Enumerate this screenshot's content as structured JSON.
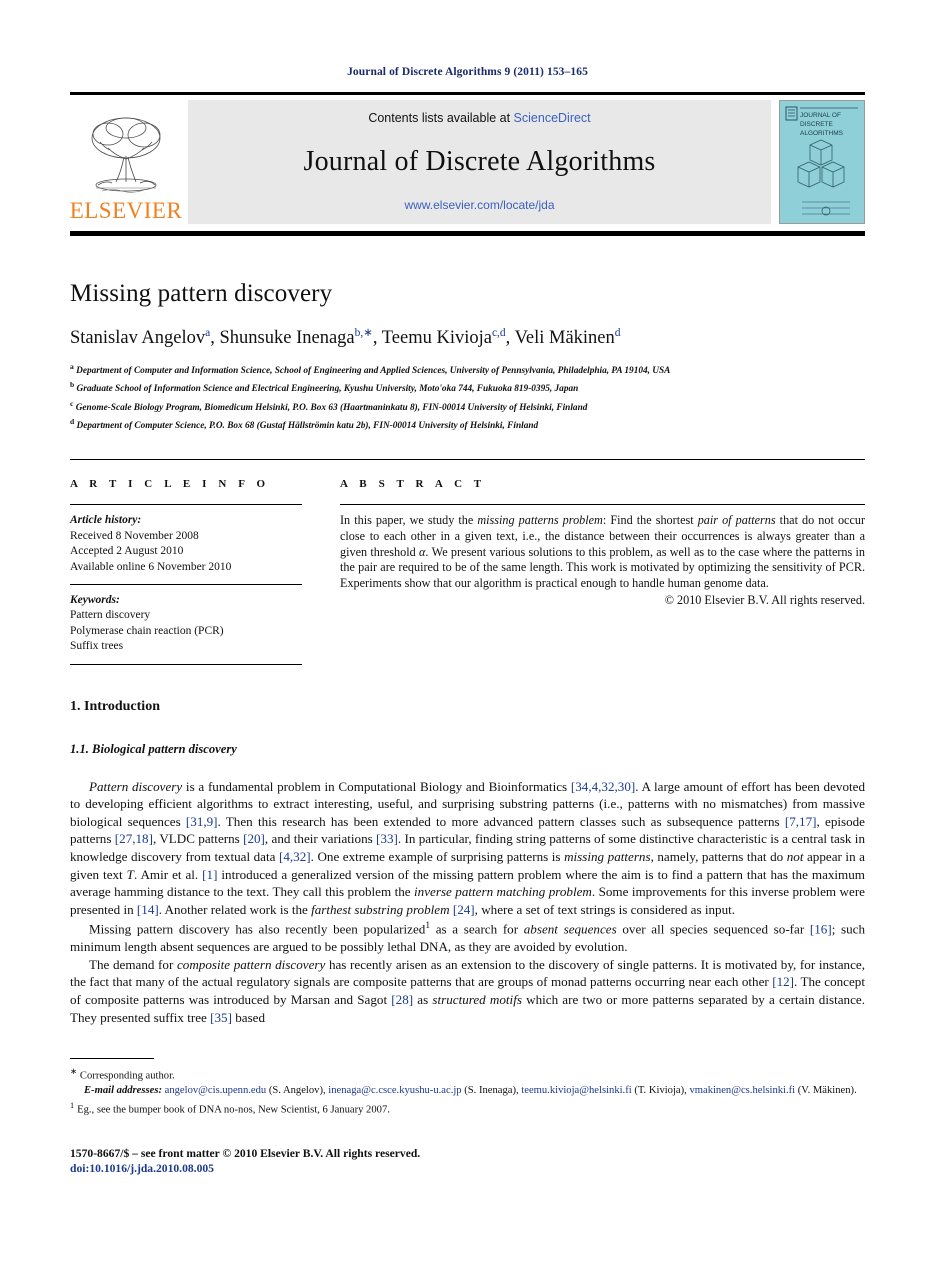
{
  "running_head": "Journal of Discrete Algorithms 9 (2011) 153–165",
  "masthead": {
    "publisher_wordmark": "ELSEVIER",
    "contents_prefix": "Contents lists available at ",
    "contents_link": "ScienceDirect",
    "journal_title": "Journal of Discrete Algorithms",
    "journal_url": "www.elsevier.com/locate/jda",
    "cover_title_lines": [
      "JOURNAL OF",
      "DISCRETE",
      "ALGORITHMS"
    ],
    "cover_color": "#8ecfd8",
    "link_color": "#3b5fc0",
    "wordmark_color": "#f08020"
  },
  "article": {
    "title": "Missing pattern discovery",
    "authors": [
      {
        "name": "Stanislav Angelov",
        "marks": "a",
        "sep": ", "
      },
      {
        "name": "Shunsuke Inenaga",
        "marks": "b,∗",
        "sep": ", "
      },
      {
        "name": "Teemu Kivioja",
        "marks": "c,d",
        "sep": ", "
      },
      {
        "name": "Veli Mäkinen",
        "marks": "d",
        "sep": ""
      }
    ],
    "affiliations": [
      {
        "letter": "a",
        "text": "Department of Computer and Information Science, School of Engineering and Applied Sciences, University of Pennsylvania, Philadelphia, PA 19104, USA"
      },
      {
        "letter": "b",
        "text": "Graduate School of Information Science and Electrical Engineering, Kyushu University, Moto'oka 744, Fukuoka 819-0395, Japan"
      },
      {
        "letter": "c",
        "text": "Genome-Scale Biology Program, Biomedicum Helsinki, P.O. Box 63 (Haartmaninkatu 8), FIN-00014 University of Helsinki, Finland"
      },
      {
        "letter": "d",
        "text": "Department of Computer Science, P.O. Box 68 (Gustaf Hällströmin katu 2b), FIN-00014 University of Helsinki, Finland"
      }
    ]
  },
  "article_info": {
    "heading": "A R T I C L E   I N F O",
    "history_label": "Article history:",
    "history": [
      "Received 8 November 2008",
      "Accepted 2 August 2010",
      "Available online 6 November 2010"
    ],
    "keywords_label": "Keywords:",
    "keywords": [
      "Pattern discovery",
      "Polymerase chain reaction (PCR)",
      "Suffix trees"
    ]
  },
  "abstract": {
    "heading": "A B S T R A C T",
    "copyright": "© 2010 Elsevier B.V. All rights reserved."
  },
  "sections": {
    "intro_number_title": "1. Introduction",
    "sub_number_title": "1.1. Biological pattern discovery"
  },
  "footnotes": {
    "corresponding_mark": "∗",
    "corresponding_text": "Corresponding author.",
    "emails_label": "E-mail addresses:",
    "emails": [
      {
        "address": "angelov@cis.upenn.edu",
        "owner": " (S. Angelov), "
      },
      {
        "address": "inenaga@c.csce.kyushu-u.ac.jp",
        "owner": " (S. Inenaga), "
      },
      {
        "address": "teemu.kivioja@helsinki.fi",
        "owner": " (T. Kivioja), "
      },
      {
        "address": "vmakinen@cs.helsinki.fi",
        "owner": " (V. Mäkinen)."
      }
    ],
    "note_mark": "1",
    "note_text": "Eg., see the bumper book of DNA no-nos, New Scientist, 6 January 2007."
  },
  "footer": {
    "issn_line": "1570-8667/$ – see front matter © 2010 Elsevier B.V. All rights reserved.",
    "doi": "doi:10.1016/j.jda.2010.08.005"
  }
}
